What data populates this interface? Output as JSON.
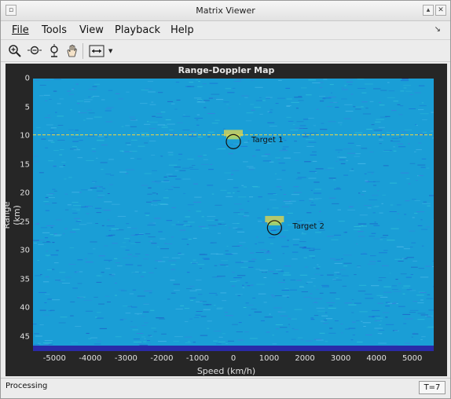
{
  "window": {
    "title": "Matrix Viewer"
  },
  "menubar": {
    "items": [
      "File",
      "Tools",
      "View",
      "Playback",
      "Help"
    ]
  },
  "toolbar": {
    "tools": [
      "zoom-in-icon",
      "zoom-out-icon",
      "pan-axis-icon",
      "hand-pan-icon",
      "fit-width-icon"
    ]
  },
  "status": {
    "left": "Processing",
    "right": "T=7"
  },
  "colors": {
    "map_bg": "#1a9ed6",
    "target_glow": "#e8d54a",
    "floor": "#2a2aa8"
  },
  "chart_data": {
    "type": "heatmap",
    "title": "Range-Doppler Map",
    "xlabel": "Speed (km/h)",
    "ylabel": "Range (km)",
    "xlim": [
      -5600,
      5600
    ],
    "ylim": [
      0,
      47.5
    ],
    "xticks": [
      -5000,
      -4000,
      -3000,
      -2000,
      -1000,
      0,
      1000,
      2000,
      3000,
      4000,
      5000
    ],
    "yticks": [
      0,
      5,
      10,
      15,
      20,
      25,
      30,
      35,
      40,
      45
    ],
    "targets": [
      {
        "label": "Target 1",
        "speed": 0,
        "range": 11
      },
      {
        "label": "Target 2",
        "speed": 1150,
        "range": 26
      }
    ],
    "clutter_line_range": 9.8
  }
}
